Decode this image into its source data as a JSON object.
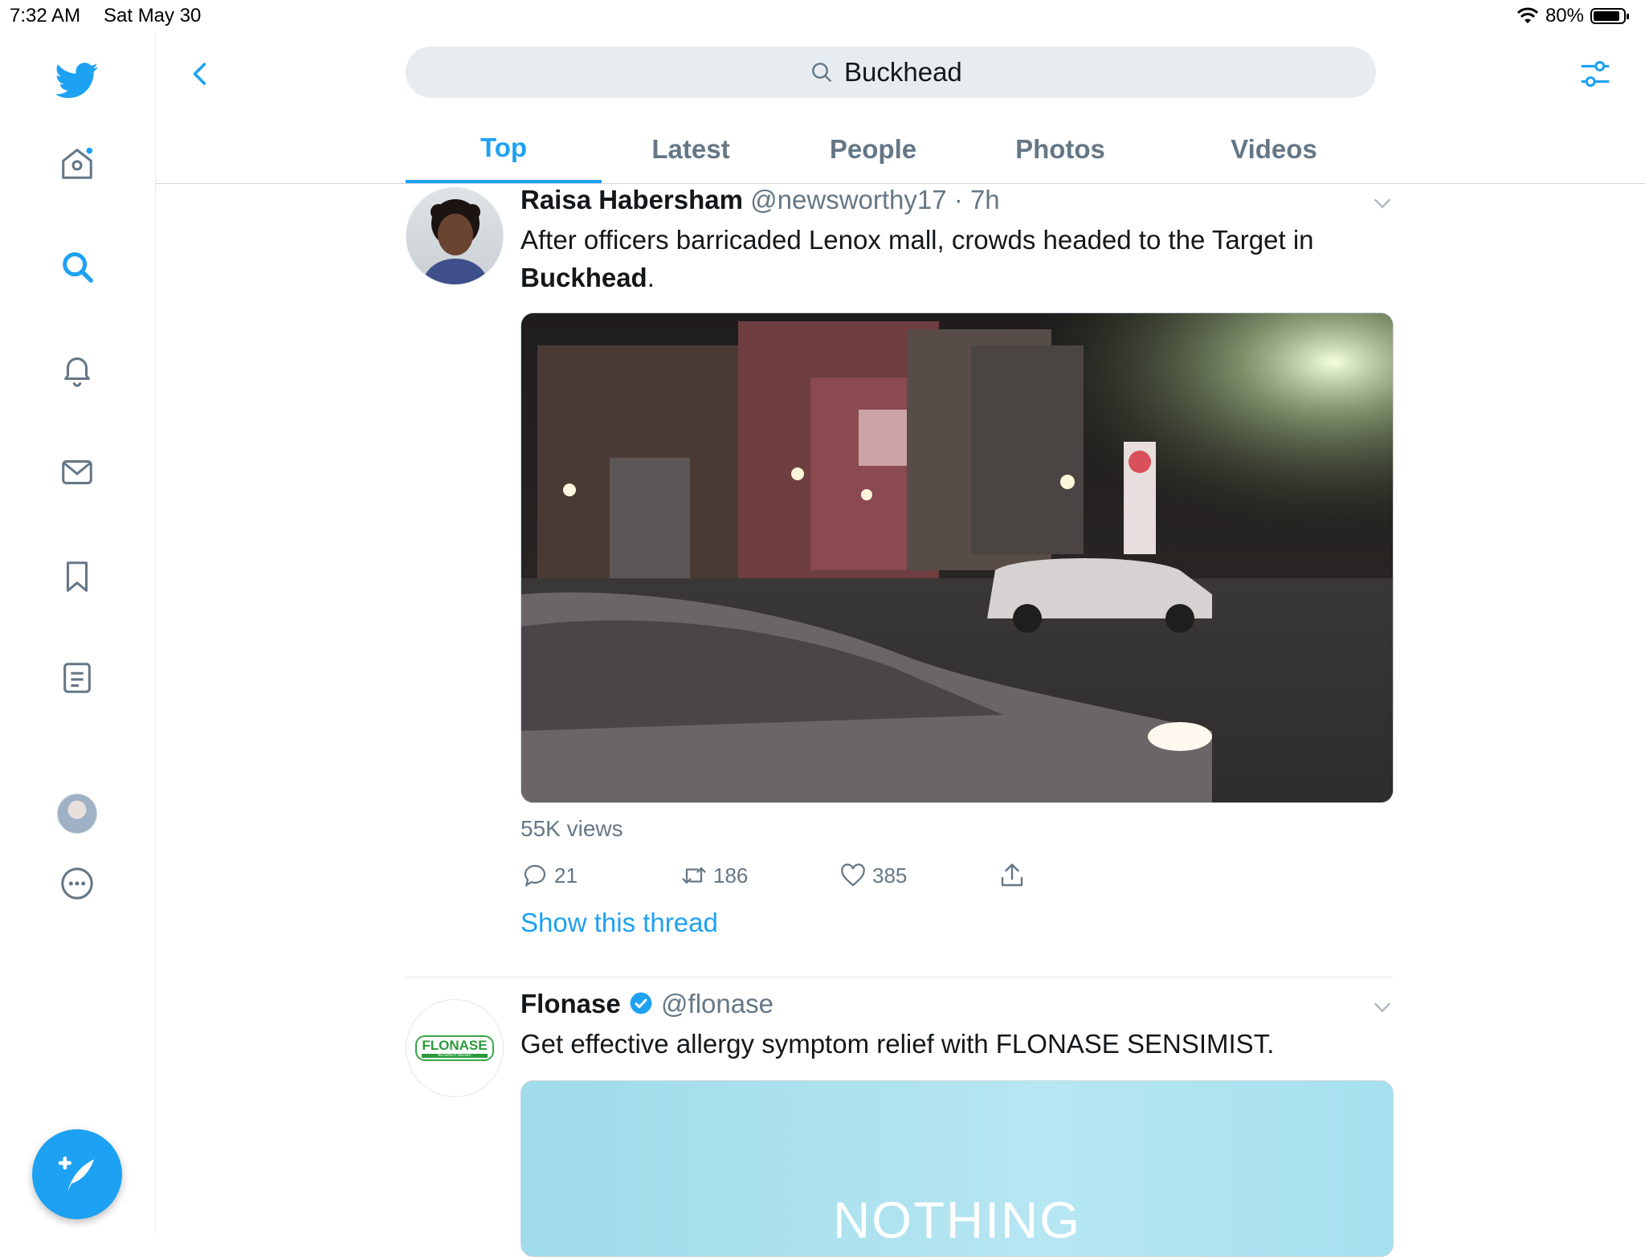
{
  "status_bar": {
    "time": "7:32 AM",
    "date": "Sat May 30",
    "battery": "80%"
  },
  "search": {
    "query": "Buckhead"
  },
  "tabs": [
    {
      "label": "Top",
      "active": true
    },
    {
      "label": "Latest",
      "active": false
    },
    {
      "label": "People",
      "active": false
    },
    {
      "label": "Photos",
      "active": false
    },
    {
      "label": "Videos",
      "active": false
    }
  ],
  "sidebar": {
    "icons": [
      "twitter-bird-icon",
      "home-icon",
      "search-icon",
      "notifications-bell-icon",
      "messages-envelope-icon",
      "bookmark-icon",
      "lists-icon",
      "profile-avatar",
      "more-icon"
    ],
    "active": "search-icon"
  },
  "tweets": [
    {
      "name": "Raisa Habersham",
      "handle": "@newsworthy17",
      "time": "7h",
      "text_before": "After officers barricaded Lenox mall, crowds headed to the Target in ",
      "text_bold": "Buckhead",
      "text_after": ".",
      "views": "55K views",
      "replies": "21",
      "retweets": "186",
      "likes": "385",
      "thread_link": "Show this thread"
    },
    {
      "name": "Flonase",
      "handle": "@flonase",
      "verified": true,
      "avatar_text": "FLONASE",
      "avatar_subtext": "ALLERGY RELIEF",
      "text": "Get effective allergy symptom relief with FLONASE SENSIMIST.",
      "media_text": "NOTHING"
    }
  ],
  "colors": {
    "accent": "#1da1f2",
    "muted": "#657786",
    "text": "#14171a"
  }
}
